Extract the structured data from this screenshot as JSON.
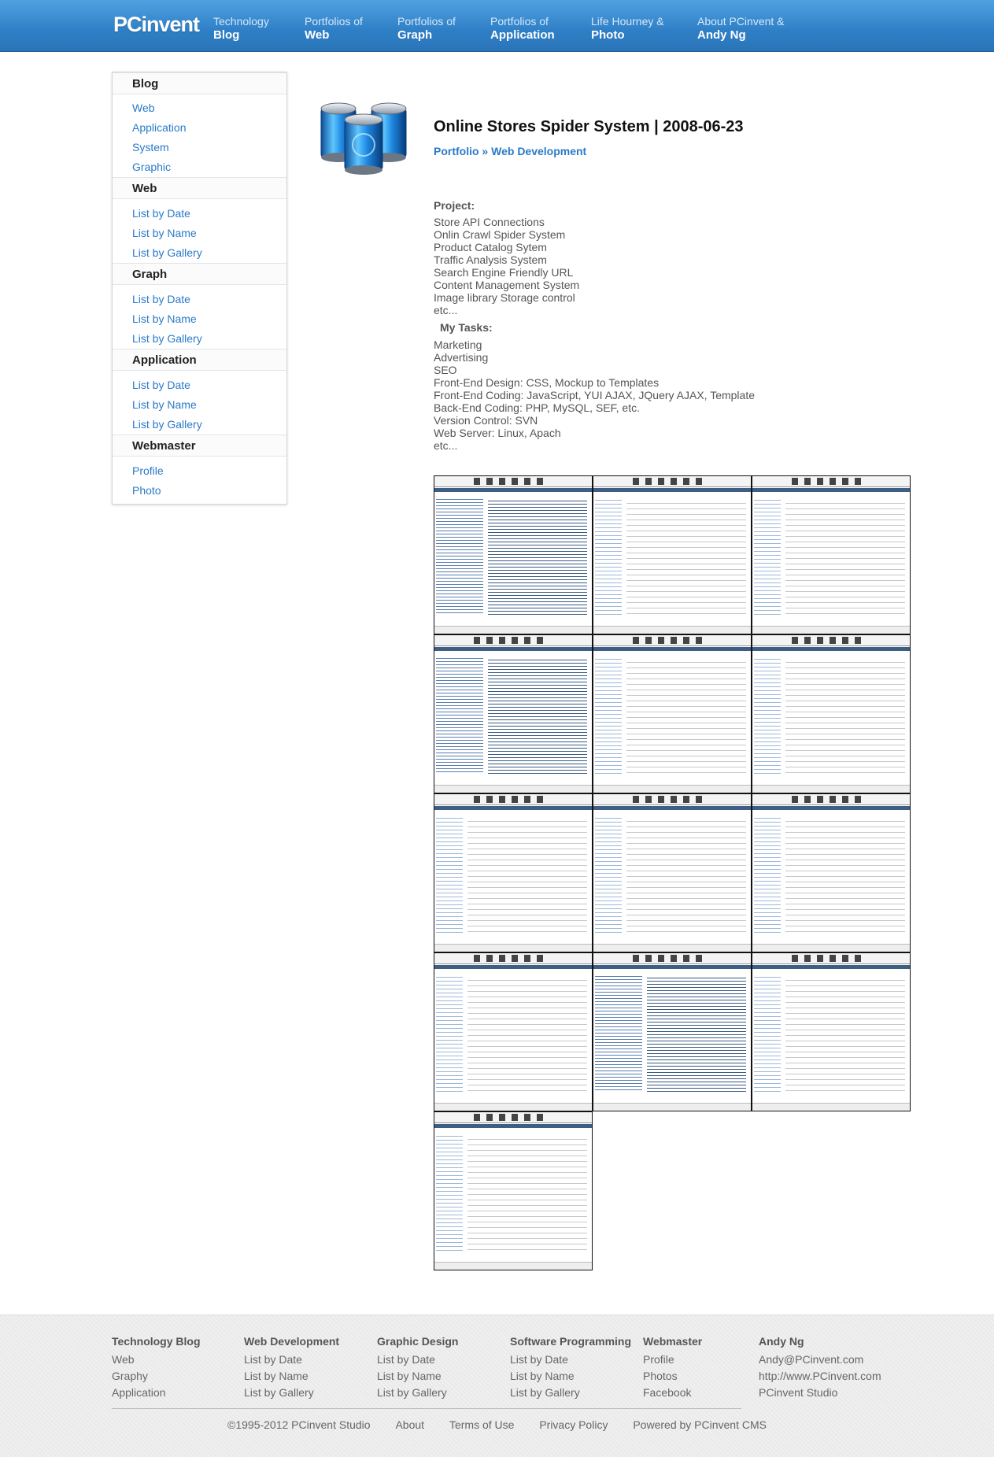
{
  "header": {
    "logo": "PCinvent",
    "nav": [
      {
        "top": "Technology",
        "bottom": "Blog"
      },
      {
        "top": "Portfolios of",
        "bottom": "Web"
      },
      {
        "top": "Portfolios of",
        "bottom": "Graph"
      },
      {
        "top": "Portfolios of",
        "bottom": "Application"
      },
      {
        "top": "Life Hourney &",
        "bottom": "Photo"
      },
      {
        "top": "About PCinvent &",
        "bottom": "Andy Ng"
      }
    ]
  },
  "sidebar": {
    "sections": [
      {
        "title": "Blog",
        "links": [
          "Web",
          "Application",
          "System",
          "Graphic"
        ]
      },
      {
        "title": "Web",
        "links": [
          "List by Date",
          "List by Name",
          "List by Gallery"
        ]
      },
      {
        "title": "Graph",
        "links": [
          "List by Date",
          "List by Name",
          "List by Gallery"
        ]
      },
      {
        "title": "Application",
        "links": [
          "List by Date",
          "List by Name",
          "List by Gallery"
        ]
      },
      {
        "title": "Webmaster",
        "links": [
          "Profile",
          "Photo"
        ]
      }
    ]
  },
  "main": {
    "title": "Online Stores Spider System | 2008-06-23",
    "breadcrumb": {
      "part1": "Portfolio",
      "sep": " » ",
      "part2": "Web Development"
    },
    "project_label": "Project:",
    "project_items": [
      "Store API Connections",
      "Onlin Crawl Spider System",
      "Product Catalog Sytem",
      "Traffic Analysis System",
      "Search Engine Friendly URL",
      "Content Management System",
      "Image library Storage control",
      "etc..."
    ],
    "tasks_label": "My Tasks:",
    "tasks_items": [
      "Marketing",
      "Advertising",
      "SEO",
      "Front-End Design: CSS, Mockup to Templates",
      "Front-End Coding: JavaScript, YUI AJAX, JQuery AJAX, Template",
      "Back-End Coding: PHP, MySQL, SEF, etc.",
      "Version Control: SVN",
      "Web Server: Linux, Apach",
      "etc..."
    ],
    "gallery_count": 13
  },
  "footer": {
    "columns": [
      {
        "head": "Technology Blog",
        "links": [
          "Web",
          "Graphy",
          "Application"
        ]
      },
      {
        "head": "Web Development",
        "links": [
          "List by Date",
          "List by Name",
          "List by Gallery"
        ]
      },
      {
        "head": "Graphic Design",
        "links": [
          "List by Date",
          "List by Name",
          "List by Gallery"
        ]
      },
      {
        "head": "Software Programming",
        "links": [
          "List by Date",
          "List by Name",
          "List by Gallery"
        ]
      },
      {
        "head": "Webmaster",
        "links": [
          "Profile",
          "Photos",
          "Facebook"
        ]
      },
      {
        "head": "Andy Ng",
        "links": [
          "Andy@PCinvent.com",
          "http://www.PCinvent.com",
          "PCinvent Studio"
        ]
      }
    ],
    "bottom": [
      "©1995-2012 PCinvent Studio",
      "About",
      "Terms of Use",
      "Privacy Policy",
      "Powered by PCinvent CMS"
    ]
  }
}
